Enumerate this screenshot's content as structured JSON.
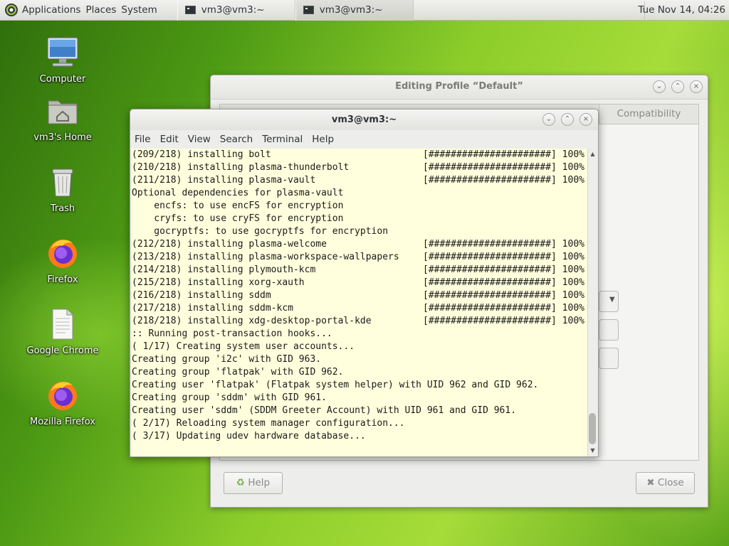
{
  "top_panel": {
    "applications": "Applications",
    "places": "Places",
    "system": "System",
    "tasks": [
      {
        "label": "vm3@vm3:~",
        "icon": "terminal-icon"
      },
      {
        "label": "vm3@vm3:~",
        "icon": "terminal-icon"
      }
    ],
    "clock": "Tue Nov 14, 04:26"
  },
  "desktop_icons": [
    {
      "label": "Computer",
      "icon": "computer-icon"
    },
    {
      "label": "vm3's Home",
      "icon": "home-folder-icon"
    },
    {
      "label": "Trash",
      "icon": "trash-icon"
    },
    {
      "label": "Firefox",
      "icon": "firefox-icon"
    },
    {
      "label": "Google Chrome",
      "icon": "document-icon"
    },
    {
      "label": "Mozilla Firefox",
      "icon": "firefox-icon"
    }
  ],
  "profile_dialog": {
    "title": "Editing Profile “Default”",
    "tab_compatibility": "Compatibility",
    "help_label": "Help",
    "close_label": "Close"
  },
  "terminal": {
    "title": "vm3@vm3:~",
    "menu": [
      "File",
      "Edit",
      "View",
      "Search",
      "Terminal",
      "Help"
    ],
    "lines": [
      {
        "text": "(209/218) installing bolt",
        "progress": "[######################] 100%"
      },
      {
        "text": "(210/218) installing plasma-thunderbolt",
        "progress": "[######################] 100%"
      },
      {
        "text": "(211/218) installing plasma-vault",
        "progress": "[######################] 100%"
      },
      {
        "text": "Optional dependencies for plasma-vault",
        "progress": ""
      },
      {
        "text": "    encfs: to use encFS for encryption",
        "progress": ""
      },
      {
        "text": "    cryfs: to use cryFS for encryption",
        "progress": ""
      },
      {
        "text": "    gocryptfs: to use gocryptfs for encryption",
        "progress": ""
      },
      {
        "text": "(212/218) installing plasma-welcome",
        "progress": "[######################] 100%"
      },
      {
        "text": "(213/218) installing plasma-workspace-wallpapers",
        "progress": "[######################] 100%"
      },
      {
        "text": "(214/218) installing plymouth-kcm",
        "progress": "[######################] 100%"
      },
      {
        "text": "(215/218) installing xorg-xauth",
        "progress": "[######################] 100%"
      },
      {
        "text": "(216/218) installing sddm",
        "progress": "[######################] 100%"
      },
      {
        "text": "(217/218) installing sddm-kcm",
        "progress": "[######################] 100%"
      },
      {
        "text": "(218/218) installing xdg-desktop-portal-kde",
        "progress": "[######################] 100%"
      },
      {
        "text": ":: Running post-transaction hooks...",
        "progress": ""
      },
      {
        "text": "( 1/17) Creating system user accounts...",
        "progress": ""
      },
      {
        "text": "Creating group 'i2c' with GID 963.",
        "progress": ""
      },
      {
        "text": "Creating group 'flatpak' with GID 962.",
        "progress": ""
      },
      {
        "text": "Creating user 'flatpak' (Flatpak system helper) with UID 962 and GID 962.",
        "progress": ""
      },
      {
        "text": "Creating group 'sddm' with GID 961.",
        "progress": ""
      },
      {
        "text": "Creating user 'sddm' (SDDM Greeter Account) with UID 961 and GID 961.",
        "progress": ""
      },
      {
        "text": "( 2/17) Reloading system manager configuration...",
        "progress": ""
      },
      {
        "text": "( 3/17) Updating udev hardware database...",
        "progress": ""
      }
    ]
  }
}
